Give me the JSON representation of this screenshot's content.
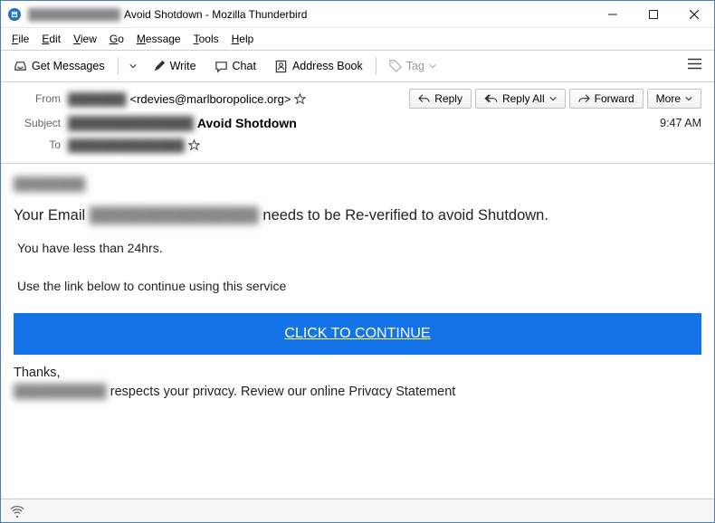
{
  "window": {
    "title_redacted": "████████████",
    "title_suffix": "Avoid Shotdown - Mozilla Thunderbird"
  },
  "menu": {
    "file": "File",
    "edit": "Edit",
    "view": "View",
    "go": "Go",
    "message": "Message",
    "tools": "Tools",
    "help": "Help"
  },
  "toolbar": {
    "get_messages": "Get Messages",
    "write": "Write",
    "chat": "Chat",
    "address_book": "Address Book",
    "tag": "Tag"
  },
  "headers": {
    "from_label": "From",
    "from_redacted": "███████",
    "from_email": "<rdevies@marlboropolice.org>",
    "subject_label": "Subject",
    "subject_redacted": "██████████████",
    "subject_text": "Avoid Shotdown",
    "to_label": "To",
    "to_redacted": "██████████████",
    "time": "9:47 AM"
  },
  "actions": {
    "reply": "Reply",
    "reply_all": "Reply All",
    "forward": "Forward",
    "more": "More"
  },
  "body": {
    "greeting_redacted": "████████",
    "line1_pre": "Your Email ",
    "line1_redacted": "████████████████",
    "line1_post": " needs to be Re-verified to avoid Shutdown.",
    "line2": "You have less than 24hrs.",
    "line3": "Use the link below to continue using this service",
    "cta": "CLICK TO CONTINUE",
    "thanks": "Thanks,",
    "priv_redacted": "██████████",
    "priv_text": " respects your privαcy. Review our online Privαcy Statement"
  }
}
